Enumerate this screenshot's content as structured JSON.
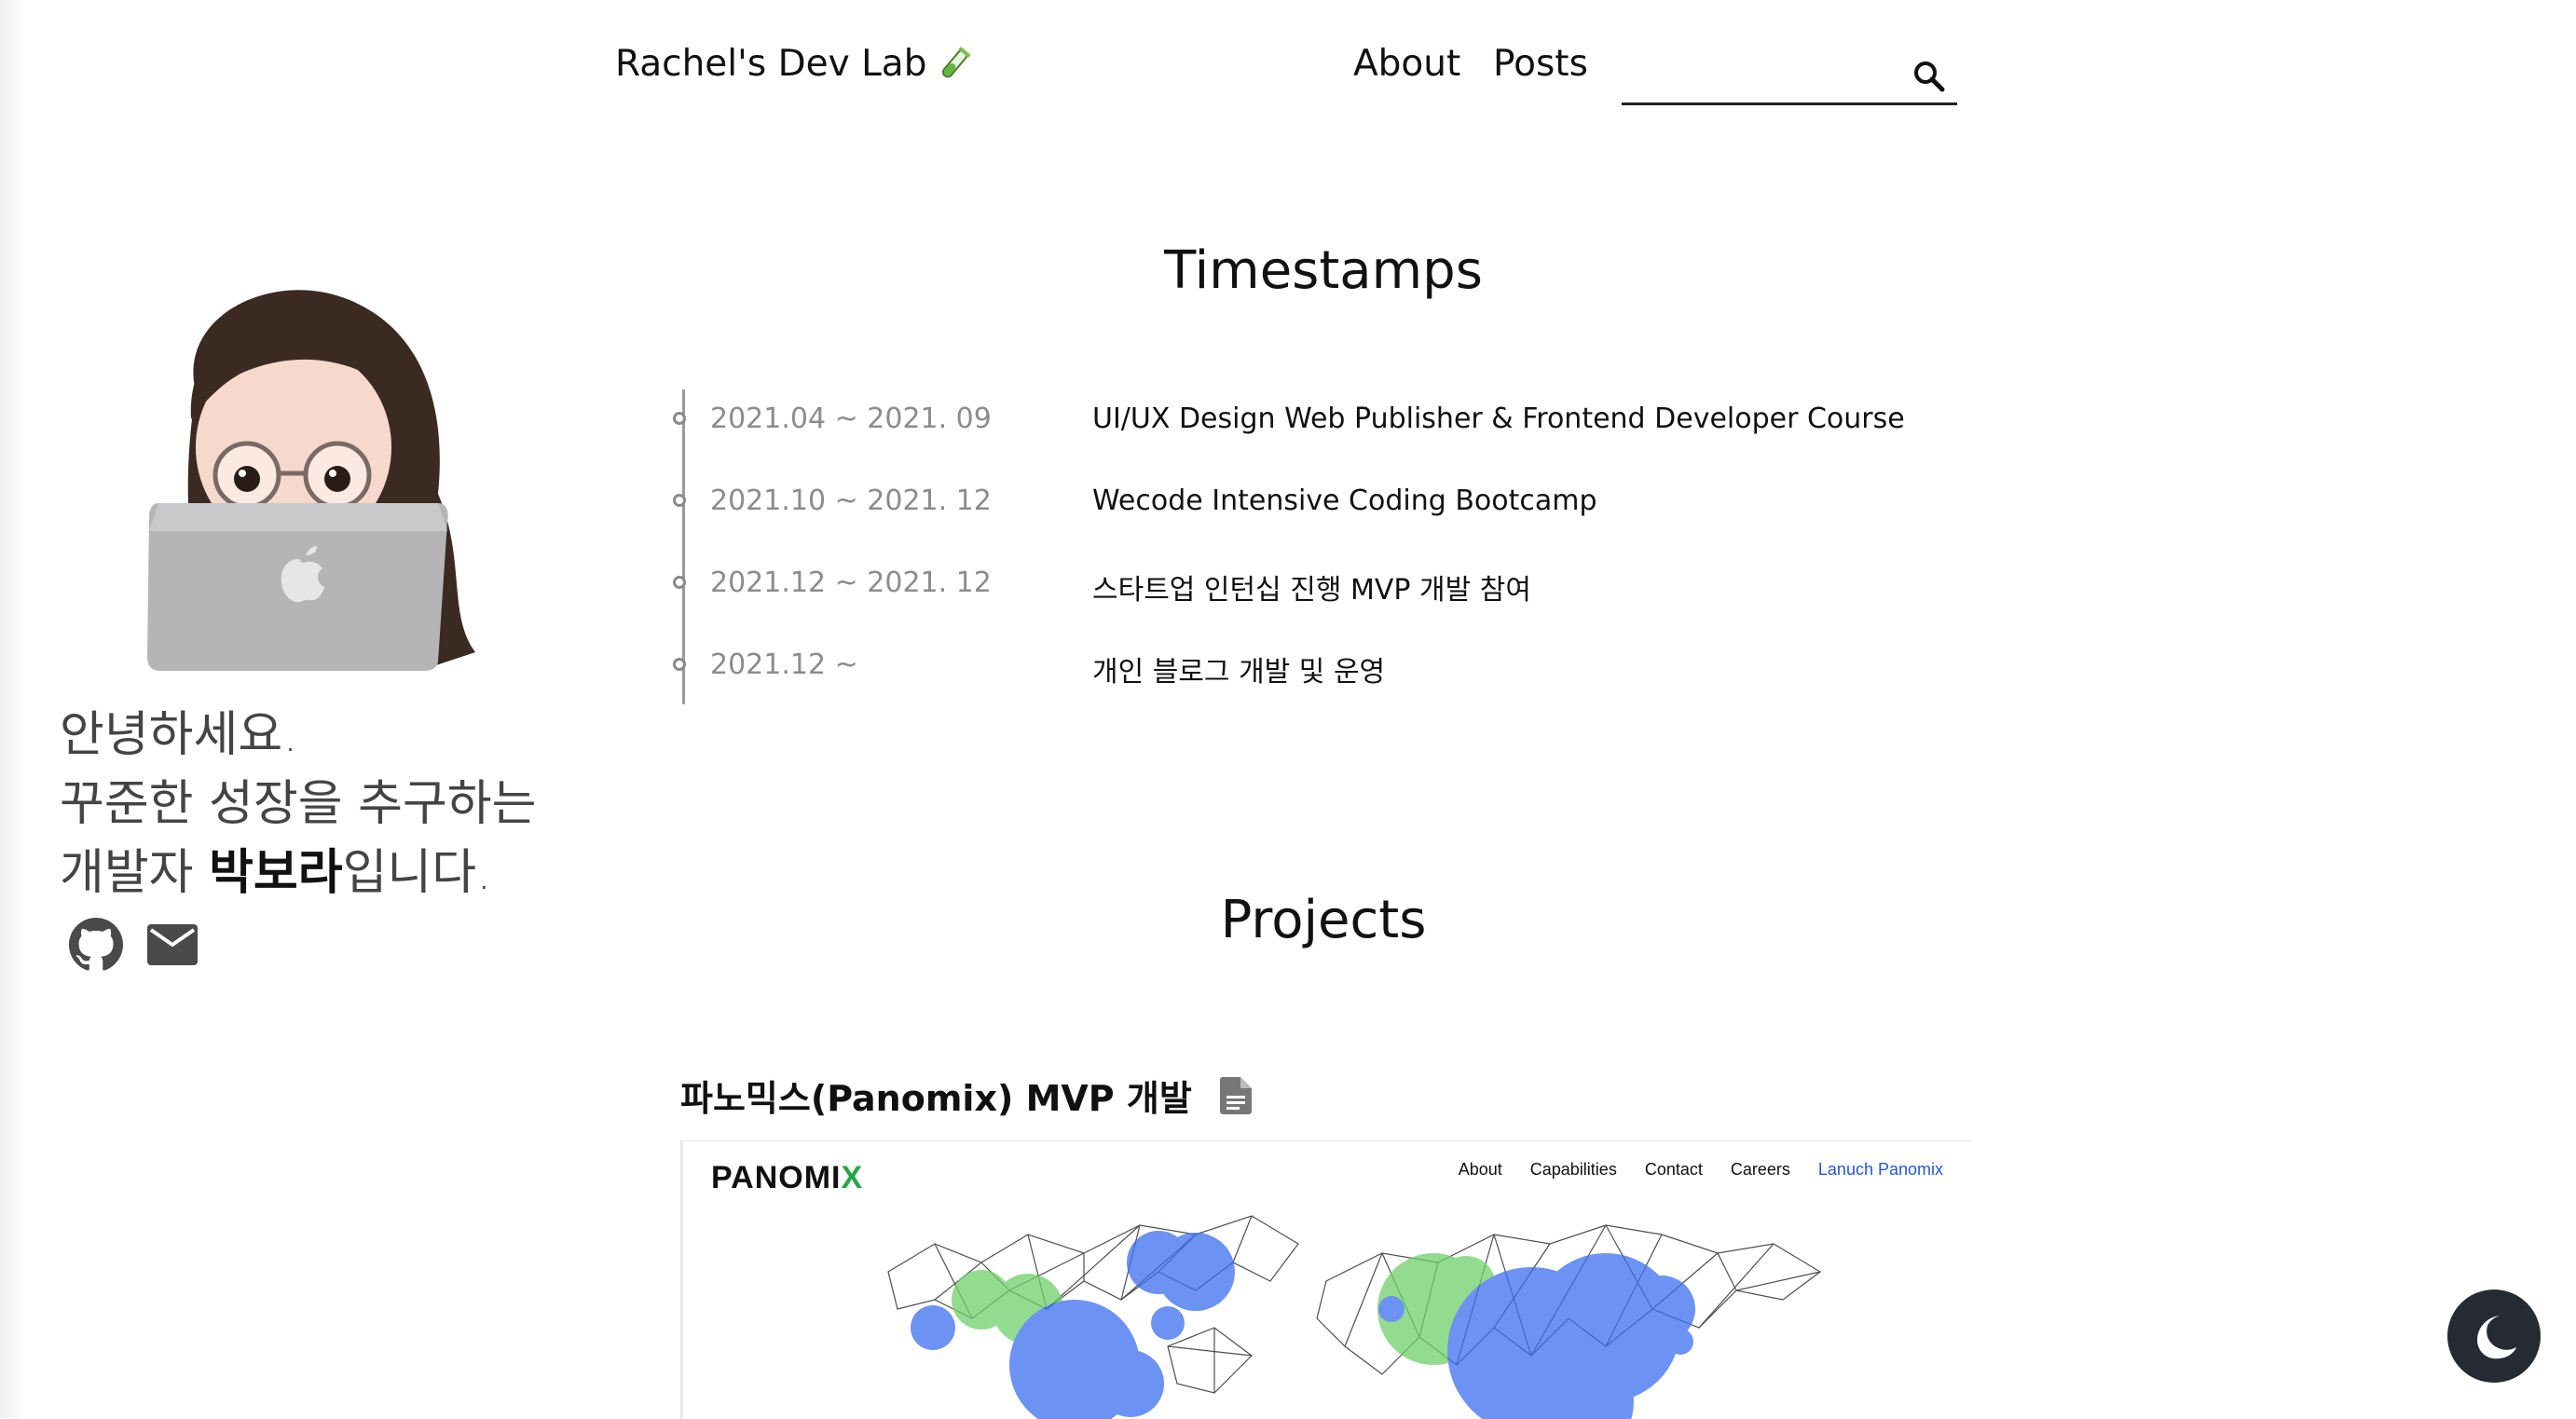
{
  "header": {
    "site_title": "Rachel's Dev Lab",
    "nav": [
      {
        "label": "About"
      },
      {
        "label": "Posts"
      }
    ],
    "search": {
      "value": "",
      "placeholder": ""
    }
  },
  "sidebar": {
    "greeting_line1": "안녕하세요.",
    "greeting_line2": "꾸준한 성장을 추구하는",
    "greeting_line3_prefix": "개발자 ",
    "greeting_name": "박보라",
    "greeting_line3_suffix": "입니다.",
    "social_icons": [
      "github-icon",
      "mail-icon"
    ]
  },
  "timestamps": {
    "title": "Timestamps",
    "items": [
      {
        "date": "2021.04 ~ 2021. 09",
        "desc": "UI/UX Design Web Publisher & Frontend Developer Course"
      },
      {
        "date": "2021.10 ~ 2021. 12",
        "desc": "Wecode Intensive Coding Bootcamp"
      },
      {
        "date": "2021.12 ~ 2021. 12",
        "desc": "스타트업 인턴십 진행 MVP 개발 참여"
      },
      {
        "date": "2021.12 ~",
        "desc": "개인 블로그 개발 및 운영"
      }
    ]
  },
  "projects": {
    "title": "Projects",
    "items": [
      {
        "title": "파노믹스(Panomix) MVP 개발",
        "screenshot": {
          "logo_prefix": "PANOMI",
          "logo_x": "X",
          "nav": [
            "About",
            "Capabilities",
            "Contact",
            "Careers",
            "Lanuch Panomix"
          ]
        }
      }
    ]
  },
  "colors": {
    "accent_green": "#27a845",
    "accent_blue": "#2456d8",
    "dark_toggle_bg": "#262b33"
  }
}
